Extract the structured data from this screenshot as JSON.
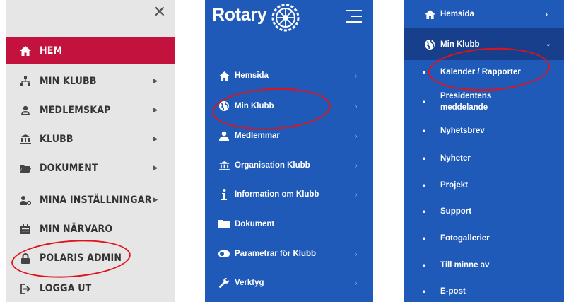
{
  "left_menu": {
    "close_glyph": "✕",
    "items": [
      {
        "label": "HEM",
        "icon": "home-icon",
        "active": true
      },
      {
        "label": "MIN KLUBB",
        "icon": "sitemap-icon"
      },
      {
        "label": "MEDLEMSKAP",
        "icon": "user-card-icon"
      },
      {
        "label": "KLUBB",
        "icon": "institution-icon"
      },
      {
        "label": "DOKUMENT",
        "icon": "folder-open-icon"
      },
      {
        "label": "MINA INSTÄLLNINGAR",
        "icon": "user-settings-icon"
      },
      {
        "label": "MIN NÄRVARO",
        "icon": "calendar-icon"
      },
      {
        "label": "POLARIS ADMIN",
        "icon": "lock-icon"
      },
      {
        "label": "LOGGA UT",
        "icon": "sign-out-icon"
      }
    ],
    "caret": "▶"
  },
  "middle_menu": {
    "logo_text": "Rotary",
    "items": [
      {
        "label": "Hemsida",
        "icon": "home-icon"
      },
      {
        "label": "Min Klubb",
        "icon": "globe-icon"
      },
      {
        "label": "Medlemmar",
        "icon": "user-icon"
      },
      {
        "label": "Organisation Klubb",
        "icon": "institution-icon"
      },
      {
        "label": "Information om Klubb",
        "icon": "info-icon"
      },
      {
        "label": "Dokument",
        "icon": "folder-icon"
      },
      {
        "label": "Parametrar för Klubb",
        "icon": "toggle-icon"
      },
      {
        "label": "Verktyg",
        "icon": "wrench-icon"
      }
    ],
    "caret": "›"
  },
  "right_menu": {
    "top_item": "Hemsida",
    "expanded_item": "Min Klubb",
    "caret": "›",
    "caret_down": "⌄",
    "bullet": "•",
    "sub_items": [
      "Kalender / Rapporter",
      "Presidentens meddelande",
      "Nyhetsbrev",
      "Nyheter",
      "Projekt",
      "Support",
      "Fotogallerier",
      "Till minne av",
      "E-post"
    ]
  },
  "colors": {
    "rotary_blue": "#1f5ab8",
    "active_red": "#c4123f",
    "highlight_ring": "#e0131b"
  }
}
